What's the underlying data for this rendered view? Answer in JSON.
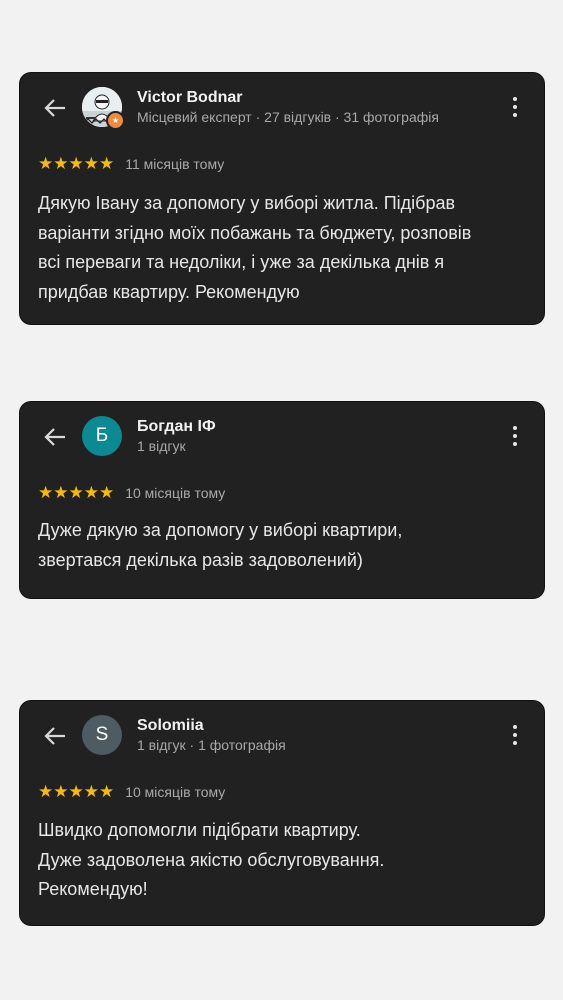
{
  "reviews": [
    {
      "author": "Victor Bodnar",
      "meta": "Місцевий експерт · 27 відгуків · 31 фотографія",
      "avatar_type": "photo",
      "avatar_badge_icon": "star-icon",
      "stars": "★★★★★",
      "rating": 5,
      "time": "11 місяців тому",
      "text": "Дякую Івану за допомогу у виборі житла. Підібрав\nваріанти згідно моїх побажань та бюджету, розповів\nвсі переваги та недоліки, і уже за декілька днів я\nпридбав квартиру. Рекомендую"
    },
    {
      "author": "Богдан ІФ",
      "meta": "1 відгук",
      "avatar_letter": "Б",
      "avatar_color": "#0b8a93",
      "stars": "★★★★★",
      "rating": 5,
      "time": "10 місяців тому",
      "text": "Дуже дякую за допомогу у виборі квартири,\nзвертався декілька разів задоволений)"
    },
    {
      "author": "Solomiia",
      "meta": "1 відгук · 1 фотографія",
      "avatar_letter": "S",
      "avatar_color": "#4d5b63",
      "stars": "★★★★★",
      "rating": 5,
      "time": "10 місяців тому",
      "text": "Швидко допомогли підібрати квартиру.\nДуже задоволена якістю обслуговування.\nРекомендую!"
    }
  ],
  "icons": {
    "back": "arrow-left-icon",
    "more": "more-vert-icon",
    "star_color": "#f6bb06"
  }
}
